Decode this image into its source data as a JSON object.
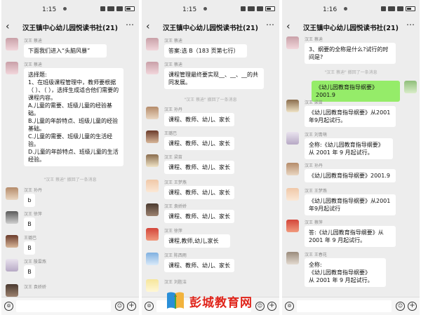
{
  "chat_title": "汉王镇中心幼儿园悦读书社(21)",
  "panels": [
    {
      "time": "1:15",
      "messages": [
        {
          "name": "汉王 蔡迪",
          "text": "下面我们进入“头脑风暴”"
        },
        {
          "name": "汉王 蔡迪",
          "text": "选择题:\n1、在班级课程管理中，教师要根据（ ）、（ ），选择生成适合他们需要的课程内容。\nA.儿童的需要、班级儿童的经验基础。\nB.儿童的年龄特点、班级儿童的经验基础。\nC.儿童的需要、班级儿童的生活经验。\nD.儿童的年龄特点、班级儿童的生活经验。"
        },
        {
          "system": "\"汉王 蔡迪\" 撤回了一条消息"
        },
        {
          "name": "汉王 孙丹",
          "text": "b"
        },
        {
          "name": "汉王 徐萍",
          "text": "B"
        },
        {
          "name": "王璐巴",
          "text": "B"
        },
        {
          "name": "汉王 殷雲燕",
          "text": "B"
        },
        {
          "name": "汉王 袁娇娇",
          "text": ""
        }
      ]
    },
    {
      "time": "1:15",
      "messages": [
        {
          "name": "汉王 蔡迪",
          "text": "答案:选 B（183 页第七行）"
        },
        {
          "name": "汉王 蔡迪",
          "text": "课程管理最终要实现__、__、__的共同发展。"
        },
        {
          "system": "\"汉王 蔡迪\" 撤回了一条消息"
        },
        {
          "name": "汉王 孙丹",
          "text": "课程、教师、幼儿、家长"
        },
        {
          "name": "王璐巴",
          "text": "课程、教师、幼儿、家长"
        },
        {
          "name": "汉王 梁苗",
          "text": "课程、教师、幼儿、家长"
        },
        {
          "name": "汉王 王梦燕",
          "text": "课程、教师、幼儿、家长"
        },
        {
          "name": "汉王 袁娇娇",
          "text": "课程、教师、幼儿、家长"
        },
        {
          "name": "汉王 徐萍",
          "text": "课程,教师,幼儿,家长"
        },
        {
          "name": "汉王 陈西雨",
          "text": "课程、教师、幼儿、家长"
        },
        {
          "name": "汉王 刘胜洁",
          "text": ""
        }
      ]
    },
    {
      "time": "1:16",
      "messages": [
        {
          "name": "汉王 蔡迪",
          "text": "3、纲要的全称是什么?试行的时间是?"
        },
        {
          "system": "\"汉王 蔡迪\" 撤回了一条消息"
        },
        {
          "self": true,
          "text": "《幼儿园教育指导纲要》2001.9"
        },
        {
          "name": "汉王 梁苗",
          "text": "《幼儿园教育指导纲要》从2001 年9月起试行。"
        },
        {
          "name": "汉王 刘青萌",
          "text": "全称:《幼儿园教育指导纲要》从 2001 年 9 月起试行。"
        },
        {
          "name": "汉王 孙丹",
          "text": "《幼儿园教育指导纲要》2001.9"
        },
        {
          "name": "汉王 王梦燕",
          "text": "《幼儿园教育指导纲要》从2001 年9月起试行"
        },
        {
          "name": "汉王 蔡萍",
          "text": "答:《幼儿园教育指导纲要》从 2001 年 9 月起试行。"
        },
        {
          "name": "汉王 王春花",
          "text": "全称:\n《幼儿园教育指导纲要》\n从 2001 年 9 月起试行。"
        }
      ]
    }
  ],
  "watermark": "彭城教育网",
  "colors": {
    "chat_bg": "#ededed",
    "bubble": "#ffffff",
    "self_bubble": "#95ec69",
    "watermark": "#e0251b"
  }
}
